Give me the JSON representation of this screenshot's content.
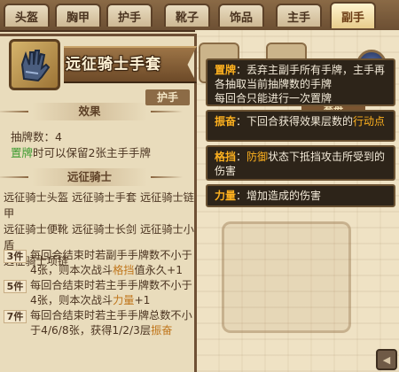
{
  "tabs": [
    "头盔",
    "胸甲",
    "护手",
    "靴子",
    "饰品",
    "主手",
    "副手"
  ],
  "item": {
    "name": "远征骑士手套",
    "type": "护手",
    "effect_header": "效果",
    "draw_label": "抽牌数：4",
    "discard_kw": "置牌",
    "discard_rest": "时可以保留2张主手手牌"
  },
  "set": {
    "header": "远征骑士",
    "pieces_line1": "远征骑士头盔 远征骑士手套 远征骑士链甲",
    "pieces_line2": "远征骑士便靴 远征骑士长剑 远征骑士小盾",
    "pieces_line3": "远征骑士项链",
    "bonuses": [
      {
        "badge": "3件",
        "text_a": "每回合结束时若副手手牌数不小于4张，则本次战斗",
        "hl": "格挡",
        "text_b": "值永久+1"
      },
      {
        "badge": "5件",
        "text_a": "每回合结束时若主手手牌数不小于4张，则本次战斗",
        "hl": "力量",
        "text_b": "+1"
      },
      {
        "badge": "7件",
        "text_a": "每回合结束时若主手手牌总数不小于4/6/8张，获得1/2/3层",
        "hl": "振奋",
        "text_b": ""
      }
    ]
  },
  "tooltips": [
    {
      "kw": "置牌",
      "text": "：丢弃主副手所有手牌，主手再各抽取当前抽牌数的手牌\n每回合只能进行一次置牌"
    },
    {
      "kw": "振奋",
      "text_a": "：下回合获得效果层数的",
      "orange": "行动点",
      "text_b": ""
    },
    {
      "kw": "格挡",
      "text_a": "：",
      "orange": "防御",
      "text_b": "状态下抵挡攻击所受到的伤害"
    },
    {
      "kw": "力量",
      "text_a": "：增加造成的伤害",
      "orange": "",
      "text_b": ""
    }
  ],
  "background": {
    "label": "套盘"
  },
  "colors": {
    "accent": "#ffb21f",
    "set_highlight": "#c0761c",
    "green": "#3c9a2f",
    "tooltip_bg": "#2d2419"
  },
  "icons": {
    "item": "gauntlet-icon",
    "corner": "arrow-icon"
  }
}
